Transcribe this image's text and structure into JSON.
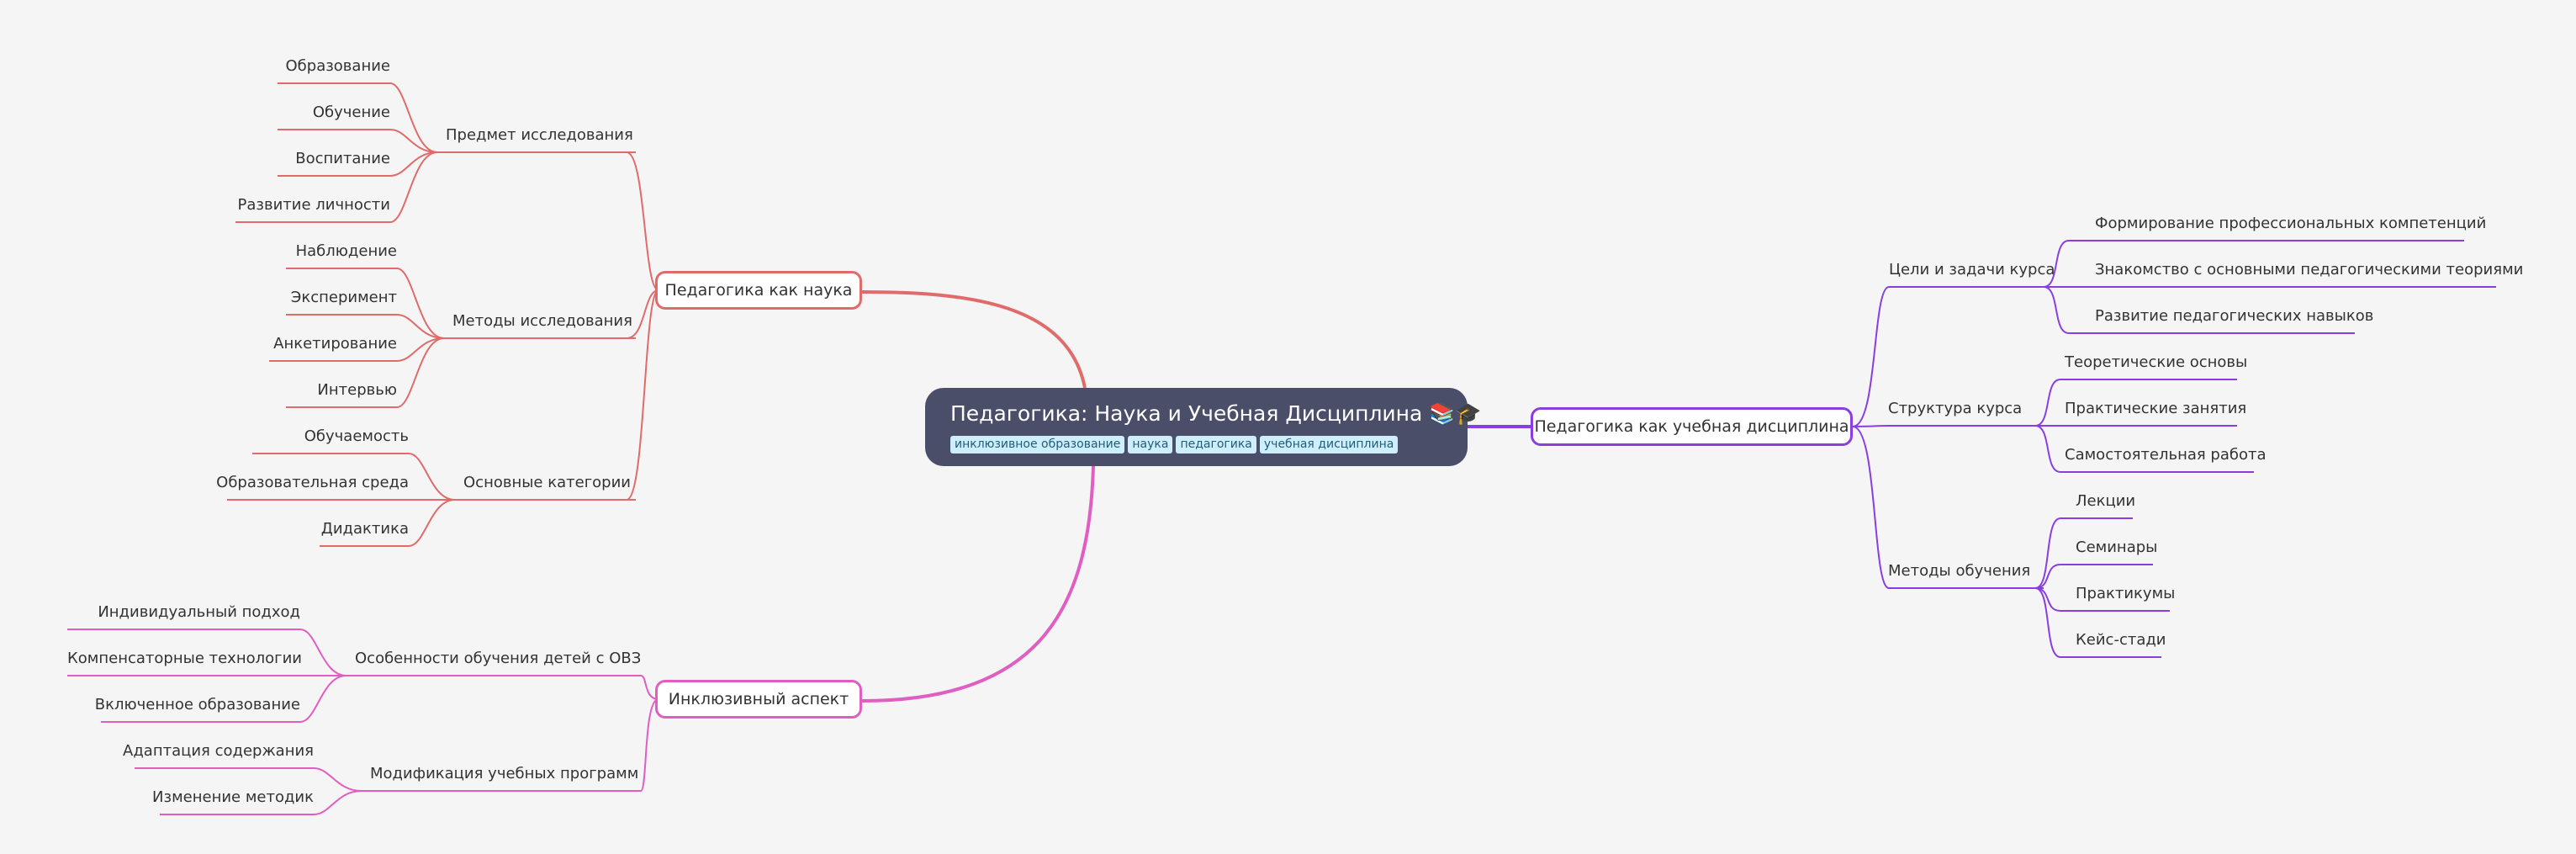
{
  "root": {
    "title": "Педагогика: Наука и Учебная Дисциплина",
    "emoji": "📚🎓",
    "tags": [
      "инклюзивное образование",
      "наука",
      "педагогика",
      "учебная дисциплина"
    ]
  },
  "branches": {
    "science": {
      "label": "Педагогика как наука",
      "color": "#e06b6b",
      "groups": [
        {
          "label": "Предмет исследования",
          "items": [
            "Образование",
            "Обучение",
            "Воспитание",
            "Развитие личности"
          ]
        },
        {
          "label": "Методы исследования",
          "items": [
            "Наблюдение",
            "Эксперимент",
            "Анкетирование",
            "Интервью"
          ]
        },
        {
          "label": "Основные категории",
          "items": [
            "Обучаемость",
            "Образовательная среда",
            "Дидактика"
          ]
        }
      ]
    },
    "inclusive": {
      "label": "Инклюзивный аспект",
      "color": "#e05ec2",
      "groups": [
        {
          "label": "Особенности обучения детей с ОВЗ",
          "items": [
            "Индивидуальный подход",
            "Компенсаторные технологии",
            "Включенное образование"
          ]
        },
        {
          "label": "Модификация учебных программ",
          "items": [
            "Адаптация содержания",
            "Изменение методик"
          ]
        }
      ]
    },
    "discipline": {
      "label": "Педагогика как учебная дисциплина",
      "color": "#8a3ee0",
      "groups": [
        {
          "label": "Цели и задачи курса",
          "items": [
            "Формирование профессиональных компетенций",
            "Знакомство с основными педагогическими теориями",
            "Развитие педагогических навыков"
          ]
        },
        {
          "label": "Структура курса",
          "items": [
            "Теоретические основы",
            "Практические занятия",
            "Самостоятельная работа"
          ]
        },
        {
          "label": "Методы обучения",
          "items": [
            "Лекции",
            "Семинары",
            "Практикумы",
            "Кейс-стади"
          ]
        }
      ]
    }
  }
}
